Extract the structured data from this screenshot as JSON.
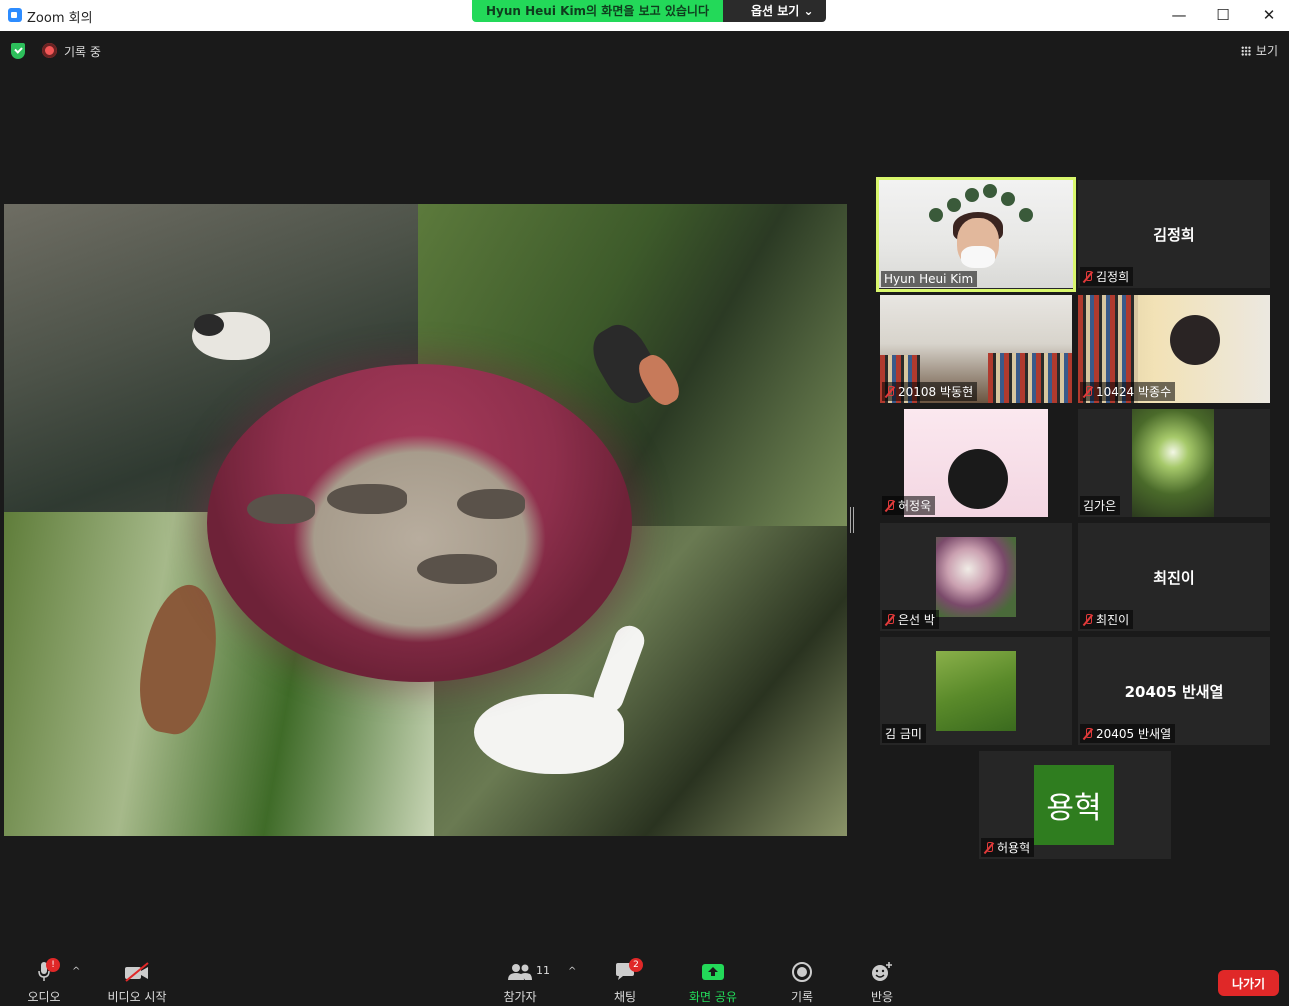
{
  "window": {
    "title": "Zoom 회의",
    "minimize": "—",
    "maximize": "☐",
    "close": "✕"
  },
  "share_banner": {
    "message": "Hyun Heui Kim의 화면을 보고 있습니다",
    "options": "옵션 보기 ⌄"
  },
  "status": {
    "recording": "기록 중",
    "view": "보기"
  },
  "participants": [
    {
      "name": "Hyun Heui Kim",
      "type": "video",
      "muted": false,
      "active": true
    },
    {
      "name": "김정희",
      "type": "name",
      "big_name": "김정희",
      "muted": true
    },
    {
      "name": "20108 박동현",
      "type": "video",
      "muted": true
    },
    {
      "name": "10424 박종수",
      "type": "video",
      "muted": true
    },
    {
      "name": "허정욱",
      "type": "video",
      "muted": true
    },
    {
      "name": "김가은",
      "type": "video",
      "muted": false
    },
    {
      "name": "은선 박",
      "type": "image",
      "muted": true
    },
    {
      "name": "최진이",
      "type": "name",
      "big_name": "최진이",
      "muted": true
    },
    {
      "name": "김 금미",
      "type": "image",
      "muted": false
    },
    {
      "name": "20405 반새열",
      "type": "name",
      "big_name": "20405 반새열",
      "muted": true
    },
    {
      "name": "허용혁",
      "type": "avatar",
      "avatar_text": "용혁",
      "avatar_color": "#2f7d1f",
      "muted": true
    }
  ],
  "toolbar": {
    "audio": "오디오",
    "audio_badge": "!",
    "video": "비디오 시작",
    "participants": "참가자",
    "participants_count": "11",
    "chat": "채팅",
    "chat_badge": "2",
    "share": "화면 공유",
    "record": "기록",
    "reactions": "반응",
    "leave": "나가기"
  },
  "colors": {
    "accent_green": "#23d959",
    "active_speaker": "#d9f76d",
    "leave_red": "#e02828"
  }
}
